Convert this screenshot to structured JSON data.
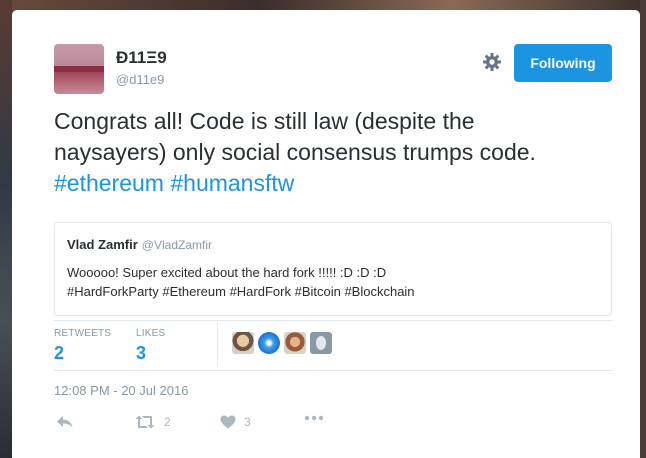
{
  "user": {
    "display_name": "Đ11Ξ9",
    "handle": "@d11e9"
  },
  "follow_button": {
    "label": "Following"
  },
  "tweet": {
    "text_line1": "Congrats all! Code is still law (despite the",
    "text_line2": "naysayers) only social consensus trumps code.",
    "hashtags": [
      "#ethereum",
      "#humansftw"
    ]
  },
  "quoted_tweet": {
    "author_name": "Vlad Zamfir",
    "author_handle": "@VladZamfir",
    "text_line1": "Wooooo! Super excited about the hard fork !!!!! :D  :D  :D",
    "text_line2": "#HardForkParty #Ethereum #HardFork #Bitcoin #Blockchain"
  },
  "stats": {
    "retweets_label": "RETWEETS",
    "retweets_value": "2",
    "likes_label": "LIKES",
    "likes_value": "3"
  },
  "timestamp": "12:08 PM - 20 Jul 2016",
  "actions": {
    "reply_icon": "reply-icon",
    "retweet_icon": "retweet-icon",
    "retweet_count": "2",
    "like_icon": "heart-icon",
    "like_count": "3",
    "more_icon": "more-icon"
  },
  "colors": {
    "accent": "#1b95e0",
    "text": "#292f33",
    "muted": "#8899a6"
  }
}
